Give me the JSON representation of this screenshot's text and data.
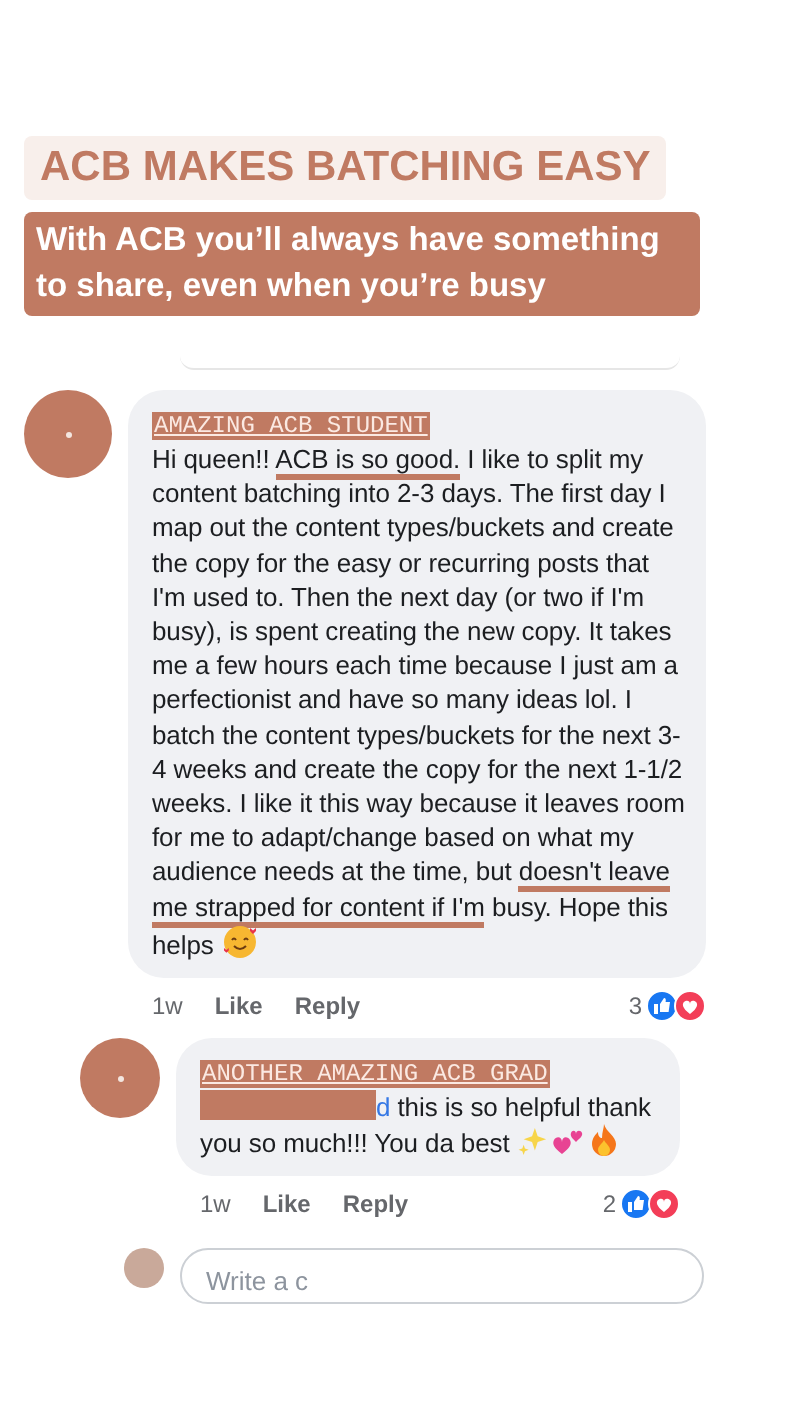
{
  "header": {
    "title": "ACB MAKES BATCHING EASY",
    "subtitle": "With ACB you’ll always have something to share, even when you’re busy"
  },
  "comments": [
    {
      "kind": "comment",
      "author": "AMAZING ACB STUDENT",
      "redacted_mention": false,
      "body": [
        {
          "text": "Hi queen!! ",
          "underlined": false
        },
        {
          "text": "ACB is so good.",
          "underlined": true
        },
        {
          "text": " I like to split my content batching into 2-3 days. The first day I map out the content types/buckets and create the copy for the easy or recurring posts that I'm used to. Then the next day (or two if I'm busy), is spent creating the new copy. It takes me a few hours each time because I just am a perfectionist and have so many ideas lol. I batch the content types/buckets for the next 3-4 weeks and create the copy for the next 1-1/2 weeks. I like it this way because it leaves room for me to adapt/change based on what my audience needs at the time, but ",
          "underlined": false
        },
        {
          "text": "doesn't leave me strapped for content if I'm",
          "underlined": true
        },
        {
          "text": " busy. Hope this helps",
          "underlined": false
        }
      ],
      "emojis": [
        {
          "kind": "smiling-face"
        }
      ],
      "time": "1w",
      "like": "Like",
      "reply": "Reply",
      "reactions": "3"
    },
    {
      "kind": "reply",
      "author": "ANOTHER AMAZING ACB GRAD",
      "redacted_mention": true,
      "mention_tail": "d",
      "body": [
        {
          "text": " this is so helpful thank you so much!!! You da best",
          "underlined": false
        }
      ],
      "emojis": [
        {
          "kind": "sparkles"
        },
        {
          "kind": "hearts"
        },
        {
          "kind": "fire"
        }
      ],
      "time": "1w",
      "like": "Like",
      "reply": "Reply",
      "reactions": "2"
    }
  ],
  "composer": {
    "placeholder": "Write a c"
  }
}
